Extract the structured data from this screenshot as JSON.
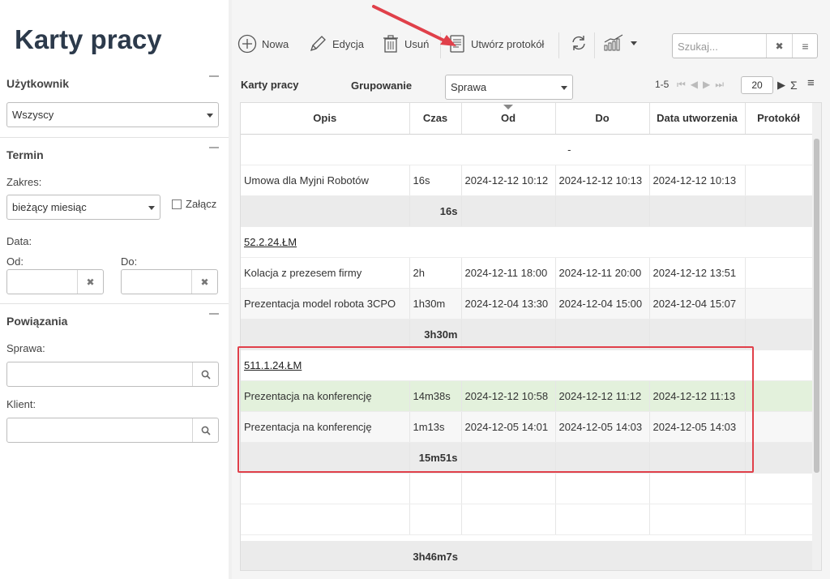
{
  "window": {
    "minimize": "–",
    "maximize": "☐",
    "close": "✕"
  },
  "app_title": "Karty pracy",
  "sidebar": {
    "user_section": {
      "title": "Użytkownik",
      "select_value": "Wszyscy"
    },
    "term_section": {
      "title": "Termin",
      "range_label": "Zakres:",
      "range_value": "bieżący miesiąc",
      "attach_label": "Załącz",
      "date_label": "Data:",
      "from_label": "Od:",
      "to_label": "Do:"
    },
    "links_section": {
      "title": "Powiązania",
      "case_label": "Sprawa:",
      "client_label": "Klient:"
    }
  },
  "toolbar": {
    "new_label": "Nowa",
    "edit_label": "Edycja",
    "delete_label": "Usuń",
    "protocol_label": "Utwórz protokół",
    "search_placeholder": "Szukaj..."
  },
  "grid": {
    "title": "Karty pracy",
    "grouping_label": "Grupowanie",
    "grouping_value": "Sprawa",
    "pager_range": "1-5",
    "page_size": "20",
    "columns": [
      "Opis",
      "Czas",
      "Od",
      "Do",
      "Data utworzenia",
      "Protokół"
    ],
    "rows": [
      {
        "type": "group",
        "label": "-"
      },
      {
        "type": "data",
        "opis": "Umowa dla Myjni Robotów",
        "czas": "16s",
        "od": "2024-12-12 10:12",
        "do": "2024-12-12 10:13",
        "created": "2024-12-12 10:13",
        "protocol": ""
      },
      {
        "type": "subtotal",
        "czas": "16s"
      },
      {
        "type": "group",
        "label": "52.2.24.ŁM"
      },
      {
        "type": "data",
        "opis": "Kolacja z prezesem firmy",
        "czas": "2h",
        "od": "2024-12-11 18:00",
        "do": "2024-12-11 20:00",
        "created": "2024-12-12 13:51",
        "protocol": ""
      },
      {
        "type": "data",
        "opis": "Prezentacja model robota 3CPO",
        "czas": "1h30m",
        "od": "2024-12-04 13:30",
        "do": "2024-12-04 15:00",
        "created": "2024-12-04 15:07",
        "protocol": ""
      },
      {
        "type": "subtotal",
        "czas": "3h30m"
      },
      {
        "type": "group",
        "label": "511.1.24.ŁM"
      },
      {
        "type": "data",
        "selected": true,
        "opis": "Prezentacja na konferencję",
        "czas": "14m38s",
        "od": "2024-12-12 10:58",
        "do": "2024-12-12 11:12",
        "created": "2024-12-12 11:13",
        "protocol": ""
      },
      {
        "type": "data",
        "opis": "Prezentacja na konferencję",
        "czas": "1m13s",
        "od": "2024-12-05 14:01",
        "do": "2024-12-05 14:03",
        "created": "2024-12-05 14:03",
        "protocol": ""
      },
      {
        "type": "subtotal",
        "czas": "15m51s"
      },
      {
        "type": "empty"
      },
      {
        "type": "empty"
      }
    ],
    "grand_total": "3h46m7s"
  },
  "colors": {
    "annotation": "#e0404a",
    "selected_row": "#e3f1dc",
    "subtotal_row": "#ebebeb"
  }
}
